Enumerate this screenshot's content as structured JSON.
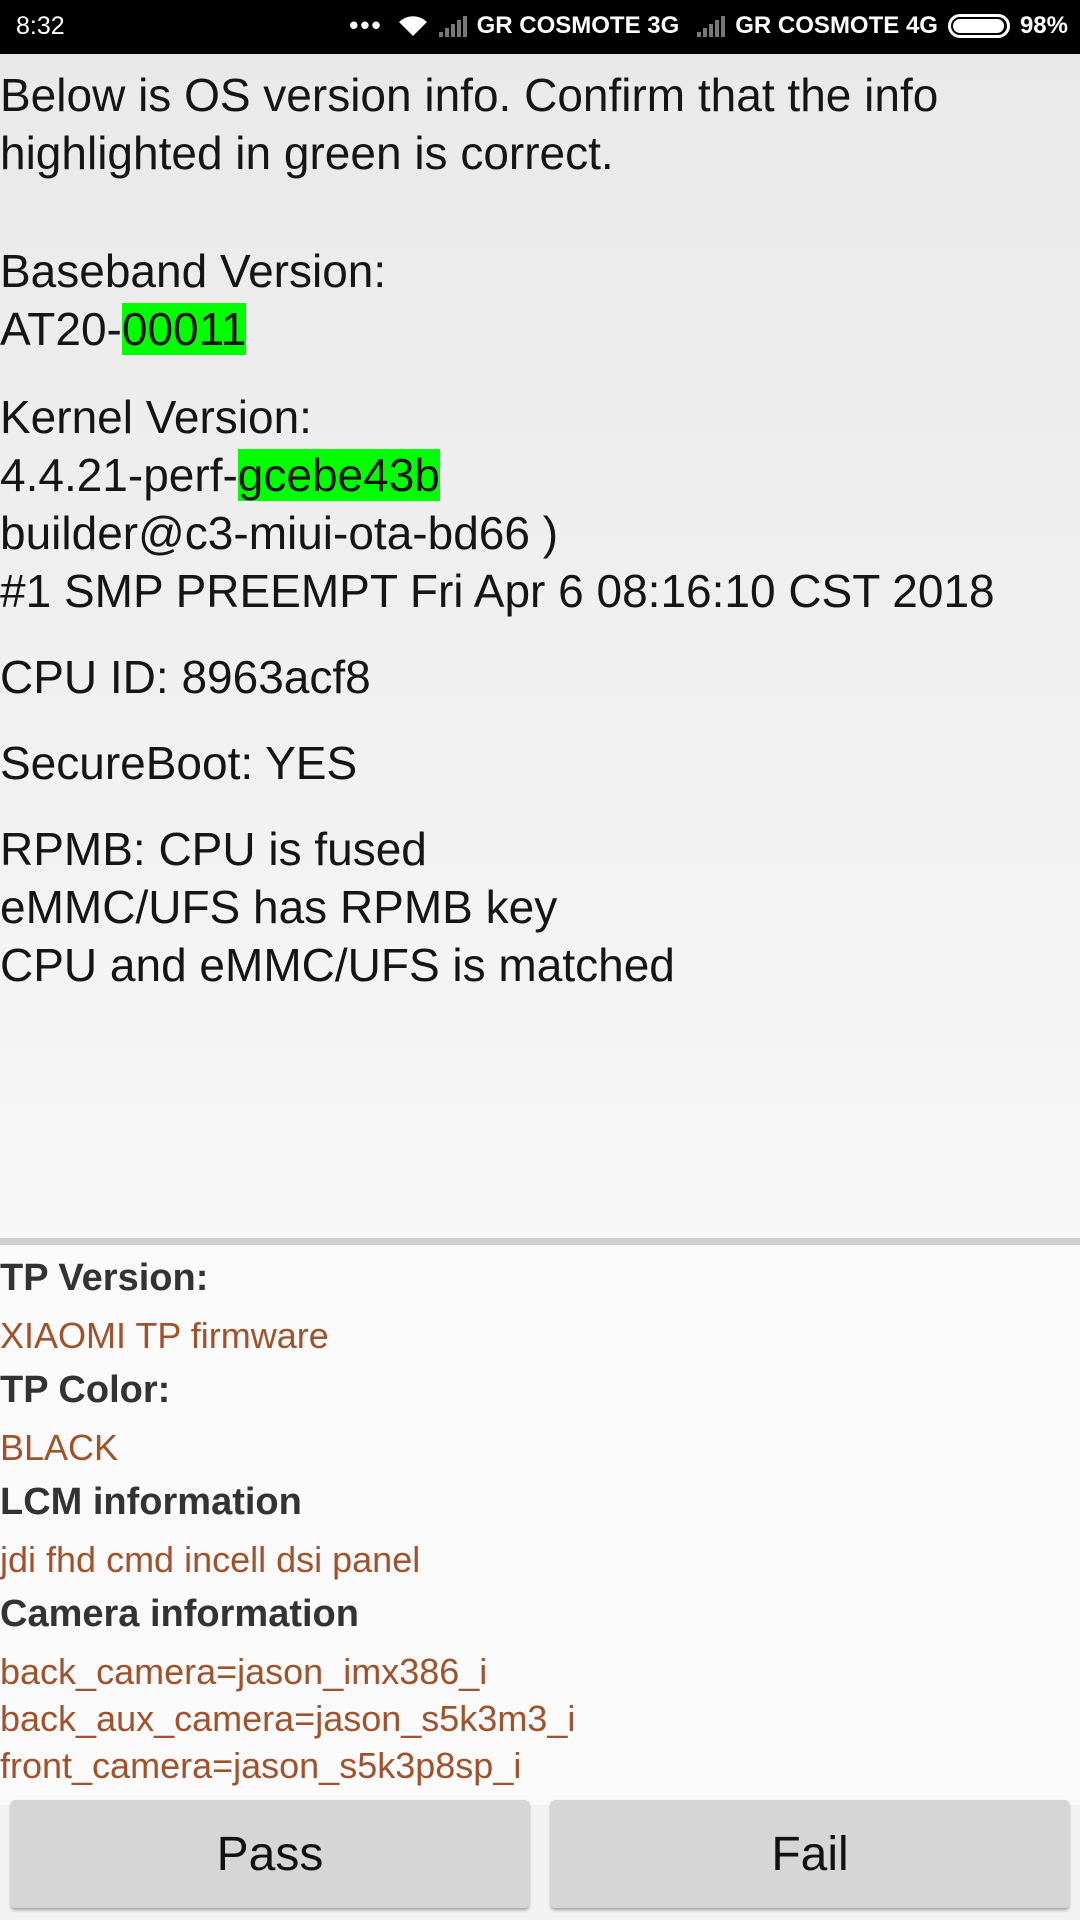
{
  "status_bar": {
    "time": "8:32",
    "dots": "•••",
    "carrier1": "GR COSMOTE 3G",
    "carrier2": "GR COSMOTE 4G",
    "battery": "98%",
    "battery_level": 0.98
  },
  "info": {
    "intro_line1": "Below is OS version info. Confirm that the info",
    "intro_line2": "highlighted in green is correct.",
    "baseband_label": "Baseband Version:",
    "baseband_prefix": "AT20-",
    "baseband_highlight": "00011",
    "kernel_label": "Kernel Version:",
    "kernel_prefix": "4.4.21-perf-",
    "kernel_highlight": "gcebe43b",
    "kernel_builder": "builder@c3-miui-ota-bd66 )",
    "kernel_build": "#1 SMP PREEMPT Fri Apr 6 08:16:10 CST 2018",
    "cpu_id": "CPU ID: 8963acf8",
    "secureboot": "SecureBoot: YES",
    "rpmb_line1": "RPMB: CPU is fused",
    "rpmb_line2": "eMMC/UFS has RPMB key",
    "rpmb_line3": "CPU and eMMC/UFS is matched"
  },
  "details": {
    "tp_version_label": "TP Version:",
    "tp_version_value": "XIAOMI TP firmware",
    "tp_color_label": "TP Color:",
    "tp_color_value": "BLACK",
    "lcm_label": "LCM information",
    "lcm_value": "jdi fhd cmd incell dsi panel",
    "camera_label": "Camera information",
    "camera_back": "back_camera=jason_imx386_i",
    "camera_back_aux": "back_aux_camera=jason_s5k3m3_i",
    "camera_front": "front_camera=jason_s5k3p8sp_i"
  },
  "buttons": {
    "pass": "Pass",
    "fail": "Fail"
  },
  "colors": {
    "highlight": "#00ff00",
    "value_text": "#a0522d"
  }
}
